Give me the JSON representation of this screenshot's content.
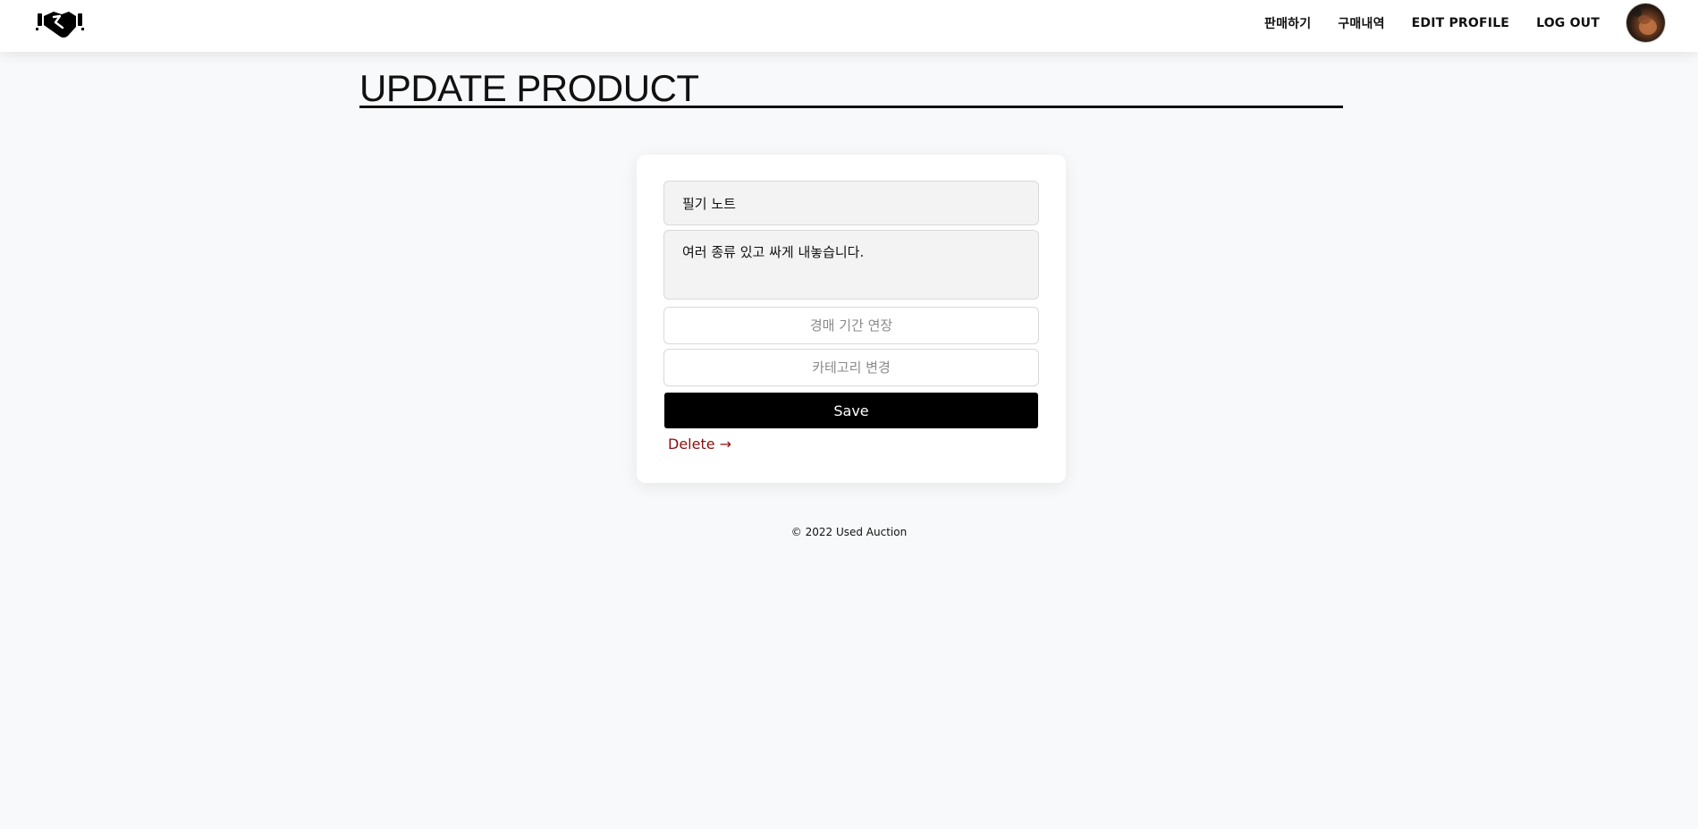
{
  "header": {
    "logo_icon": "handshake-icon",
    "nav": [
      {
        "label": "판매하기"
      },
      {
        "label": "구매내역"
      },
      {
        "label": "EDIT PROFILE"
      },
      {
        "label": "LOG OUT"
      }
    ],
    "avatar_icon": "user-avatar"
  },
  "main": {
    "title": "UPDATE PRODUCT",
    "form": {
      "name_value": "필기 노트",
      "description_value": "여러 종류 있고 싸게 내놓습니다.",
      "period_placeholder": "경매 기간 연장",
      "category_placeholder": "카테고리 변경",
      "save_label": "Save",
      "delete_label": "Delete →"
    }
  },
  "footer": {
    "copyright": "© 2022 Used Auction"
  },
  "colors": {
    "background": "#f8f9fb",
    "primary": "#000000",
    "danger": "#8b0e0e",
    "input_fill": "#f3f3f3"
  }
}
